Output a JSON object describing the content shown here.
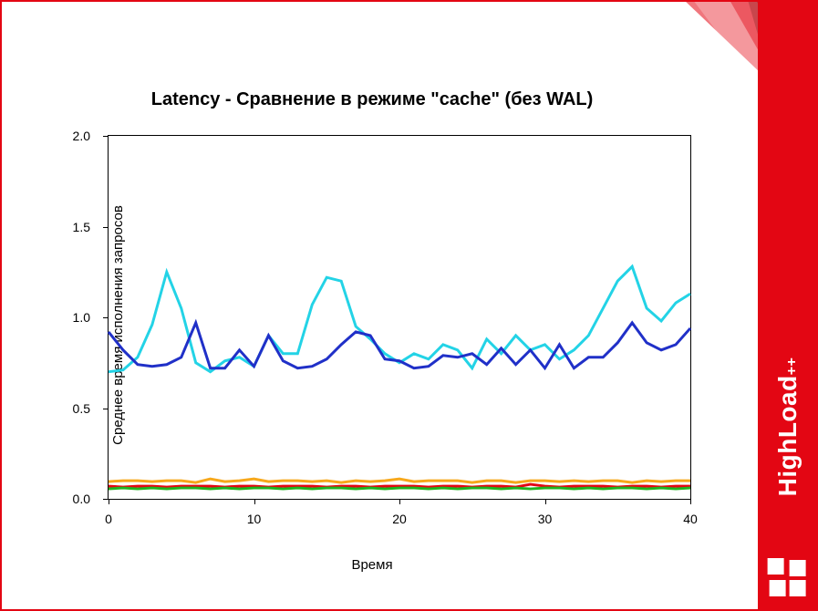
{
  "brand": {
    "name": "HighLoad",
    "suffix": "++"
  },
  "chart_data": {
    "type": "line",
    "title": "Latency - Сравнение в режиме \"cache\" (без WAL)",
    "xlabel": "Время",
    "ylabel": "Среднее время исполнения запросов",
    "xlim": [
      0,
      40
    ],
    "ylim": [
      0,
      2.0
    ],
    "x_ticks": [
      0,
      10,
      20,
      30,
      40
    ],
    "y_ticks": [
      0.0,
      0.5,
      1.0,
      1.5,
      2.0
    ],
    "x": [
      0,
      1,
      2,
      3,
      4,
      5,
      6,
      7,
      8,
      9,
      10,
      11,
      12,
      13,
      14,
      15,
      16,
      17,
      18,
      19,
      20,
      21,
      22,
      23,
      24,
      25,
      26,
      27,
      28,
      29,
      30,
      31,
      32,
      33,
      34,
      35,
      36,
      37,
      38,
      39,
      40
    ],
    "series": [
      {
        "name": "series-cyan",
        "color": "#23d3e6",
        "values": [
          0.7,
          0.71,
          0.78,
          0.96,
          1.25,
          1.05,
          0.75,
          0.7,
          0.76,
          0.78,
          0.73,
          0.9,
          0.8,
          0.8,
          1.07,
          1.22,
          1.2,
          0.95,
          0.88,
          0.8,
          0.75,
          0.8,
          0.77,
          0.85,
          0.82,
          0.72,
          0.88,
          0.8,
          0.9,
          0.82,
          0.85,
          0.77,
          0.82,
          0.9,
          1.05,
          1.2,
          1.28,
          1.05,
          0.98,
          1.08,
          1.13
        ]
      },
      {
        "name": "series-blue",
        "color": "#2030c8",
        "values": [
          0.92,
          0.82,
          0.74,
          0.73,
          0.74,
          0.78,
          0.97,
          0.72,
          0.72,
          0.82,
          0.73,
          0.9,
          0.76,
          0.72,
          0.73,
          0.77,
          0.85,
          0.92,
          0.9,
          0.77,
          0.76,
          0.72,
          0.73,
          0.79,
          0.78,
          0.8,
          0.74,
          0.83,
          0.74,
          0.82,
          0.72,
          0.85,
          0.72,
          0.78,
          0.78,
          0.86,
          0.97,
          0.86,
          0.82,
          0.85,
          0.94
        ]
      },
      {
        "name": "series-orange",
        "color": "#f7a81b",
        "values": [
          0.095,
          0.1,
          0.1,
          0.095,
          0.1,
          0.1,
          0.09,
          0.11,
          0.095,
          0.1,
          0.11,
          0.095,
          0.1,
          0.1,
          0.095,
          0.1,
          0.09,
          0.1,
          0.095,
          0.1,
          0.11,
          0.095,
          0.1,
          0.1,
          0.1,
          0.09,
          0.1,
          0.1,
          0.09,
          0.1,
          0.1,
          0.095,
          0.1,
          0.095,
          0.1,
          0.1,
          0.09,
          0.1,
          0.095,
          0.1,
          0.1
        ]
      },
      {
        "name": "series-red",
        "color": "#e30613",
        "values": [
          0.07,
          0.065,
          0.07,
          0.07,
          0.065,
          0.07,
          0.07,
          0.07,
          0.065,
          0.07,
          0.07,
          0.065,
          0.07,
          0.07,
          0.07,
          0.065,
          0.07,
          0.07,
          0.065,
          0.07,
          0.07,
          0.07,
          0.065,
          0.07,
          0.07,
          0.065,
          0.07,
          0.07,
          0.065,
          0.08,
          0.07,
          0.065,
          0.07,
          0.07,
          0.07,
          0.065,
          0.07,
          0.07,
          0.065,
          0.07,
          0.07
        ]
      },
      {
        "name": "series-green",
        "color": "#1fb61f",
        "values": [
          0.055,
          0.06,
          0.055,
          0.06,
          0.055,
          0.06,
          0.06,
          0.055,
          0.06,
          0.055,
          0.06,
          0.06,
          0.055,
          0.06,
          0.055,
          0.06,
          0.06,
          0.055,
          0.06,
          0.055,
          0.06,
          0.06,
          0.055,
          0.06,
          0.055,
          0.06,
          0.06,
          0.055,
          0.06,
          0.055,
          0.06,
          0.06,
          0.055,
          0.06,
          0.055,
          0.06,
          0.06,
          0.055,
          0.06,
          0.055,
          0.06
        ]
      }
    ]
  }
}
